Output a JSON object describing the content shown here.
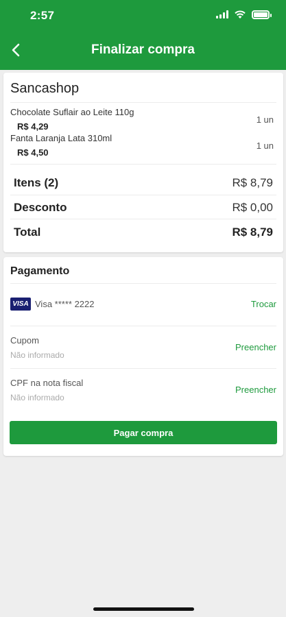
{
  "status_bar": {
    "time": "2:57"
  },
  "header": {
    "title": "Finalizar compra",
    "back_icon": "chevron-left-icon"
  },
  "order": {
    "store": "Sancashop",
    "items": [
      {
        "name": "Chocolate Suflair ao Leite 110g",
        "price": "R$ 4,29",
        "qty": "1 un"
      },
      {
        "name": "Fanta Laranja Lata 310ml",
        "price": "R$ 4,50",
        "qty": "1 un"
      }
    ],
    "summary": {
      "items_label": "Itens (2)",
      "items_value": "R$ 8,79",
      "discount_label": "Desconto",
      "discount_value": "R$ 0,00",
      "total_label": "Total",
      "total_value": "R$ 8,79"
    }
  },
  "payment": {
    "title": "Pagamento",
    "card_brand": "VISA",
    "card_number": "Visa ***** 2222",
    "change_label": "Trocar",
    "coupon_label": "Cupom",
    "coupon_value": "Não informado",
    "coupon_action": "Preencher",
    "cpf_label": "CPF na nota fiscal",
    "cpf_value": "Não informado",
    "cpf_action": "Preencher",
    "pay_button": "Pagar compra"
  },
  "colors": {
    "brand": "#1e9a3d",
    "visa": "#1a1f71"
  }
}
